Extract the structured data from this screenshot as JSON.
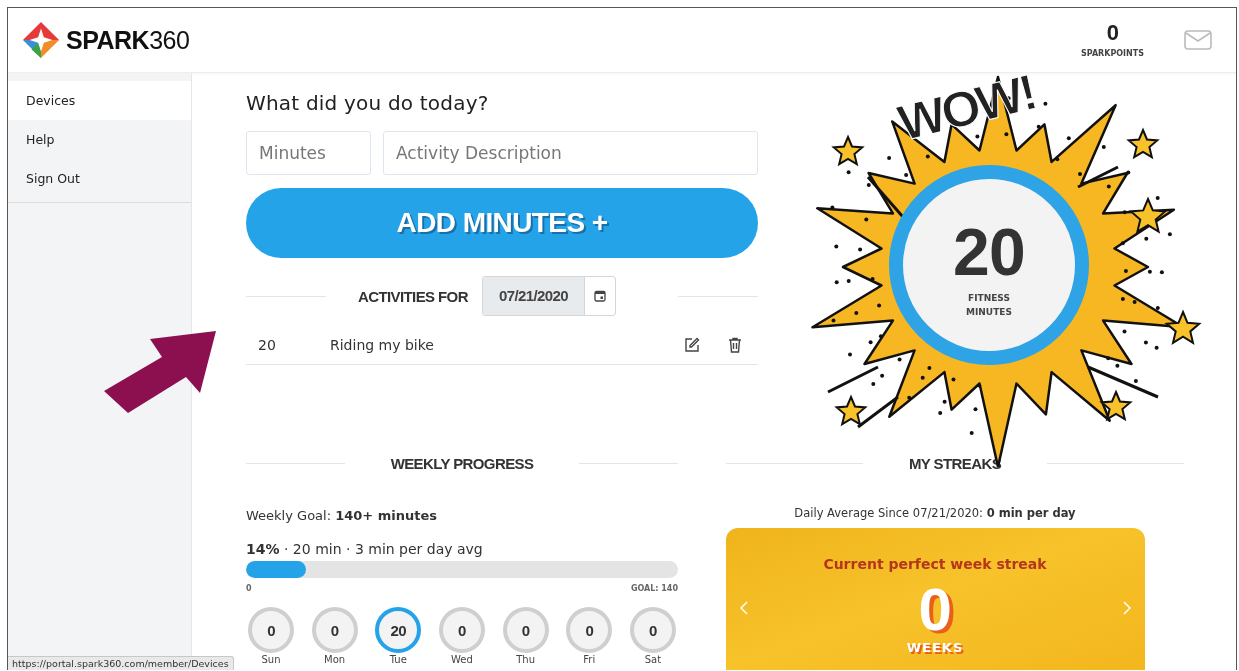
{
  "header": {
    "logo": "**SPARK**360",
    "points": {
      "value": "0",
      "label": "SPARKPOINTS"
    }
  },
  "sidebar": {
    "items": [
      {
        "label": "Devices",
        "selected": true
      },
      {
        "label": "Help",
        "selected": false
      },
      {
        "label": "Sign Out",
        "selected": false
      }
    ]
  },
  "log_form": {
    "heading": "What did you do today?",
    "minutes_field": {
      "placeholder": "Minutes"
    },
    "description_field": {
      "placeholder": "Activity Description"
    },
    "add_button": "ADD MINUTES +"
  },
  "activities": {
    "label": "ACTIVITIES FOR",
    "date": "07/21/2020",
    "rows": [
      {
        "minutes": "20",
        "description": "Riding my bike"
      }
    ]
  },
  "fitness_burst": {
    "exclamation": "WOW!",
    "value": "20",
    "label": "FITNESS MINUTES"
  },
  "weekly_progress": {
    "heading": "WEEKLY PROGRESS",
    "goal": "Weekly Goal: **140+ minutes**",
    "summary": "**14%** · 20 min · 3 min per day avg",
    "level": 0.14,
    "scale_min": "0",
    "scale_goal": "GOAL: 140",
    "days": [
      {
        "value": "0",
        "day": "Sun",
        "today": false
      },
      {
        "value": "0",
        "day": "Mon",
        "today": false
      },
      {
        "value": "20",
        "day": "Tue",
        "today": true
      },
      {
        "value": "0",
        "day": "Wed",
        "today": false
      },
      {
        "value": "0",
        "day": "Thu",
        "today": false
      },
      {
        "value": "0",
        "day": "Fri",
        "today": false
      },
      {
        "value": "0",
        "day": "Sat",
        "today": false
      }
    ]
  },
  "streaks": {
    "heading": "MY STREAKS",
    "daily_average": "Daily Average Since 07/21/2020: **0 min per day**",
    "card": {
      "title": "Current perfect week streak",
      "value": "0",
      "unit": "WEEKS"
    }
  },
  "status_bar": {
    "url": "https://portal.spark360.com/member/Devices"
  }
}
